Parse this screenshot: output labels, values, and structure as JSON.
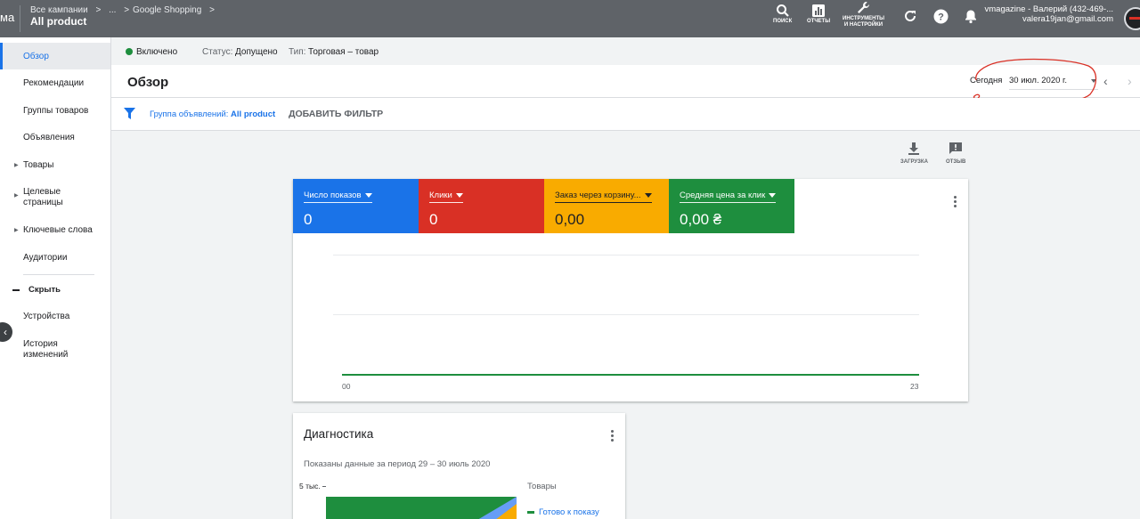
{
  "topbar": {
    "product_fragment": "ма",
    "crumb_parent": "Все кампании",
    "crumb_sep1": ">",
    "crumb_ellipsis": "...",
    "crumb_sep2": ">",
    "crumb_campaign": "Google Shopping",
    "crumb_sep3": ">",
    "page_title": "All product",
    "tools": {
      "search": "ПОИСК",
      "reports": "ОТЧЕТЫ",
      "tools_line1": "ИНСТРУМЕНТЫ",
      "tools_line2": "И НАСТРОЙКИ"
    },
    "account_name": "vmagazine - Валерий (432-469-...",
    "account_email": "valera19jan@gmail.com"
  },
  "sidebar": {
    "items": [
      {
        "label": "Обзор"
      },
      {
        "label": "Рекомендации"
      },
      {
        "label": "Группы товаров"
      },
      {
        "label": "Объявления"
      },
      {
        "label": "Товары"
      },
      {
        "label": "Целевые страницы"
      },
      {
        "label": "Ключевые слова"
      },
      {
        "label": "Аудитории"
      }
    ],
    "hide_label": "Скрыть",
    "extra_items": [
      {
        "label": "Устройства"
      },
      {
        "label": "История изменений"
      }
    ]
  },
  "status": {
    "enabled": "Включено",
    "status_label": "Статус:",
    "status_value": "Допущено",
    "type_label": "Тип:",
    "type_value": "Торговая – товар"
  },
  "header": {
    "title": "Обзор",
    "date_label": "Сегодня",
    "date_value": "30 июл. 2020 г."
  },
  "filter": {
    "group_label": "Группа объявлений:",
    "group_value": "All product",
    "add_filter": "ДОБАВИТЬ ФИЛЬТР"
  },
  "actions": {
    "download": "ЗАГРУЗКА",
    "feedback": "ОТЗЫВ"
  },
  "metrics": [
    {
      "name": "Число показов",
      "value": "0",
      "color": "#1a73e8"
    },
    {
      "name": "Клики",
      "value": "0",
      "color": "#d93025"
    },
    {
      "name": "Заказ через корзину...",
      "value": "0,00",
      "color": "#f9ab00"
    },
    {
      "name": "Средняя цена за клик",
      "value": "0,00 ₴",
      "color": "#1e8e3e"
    }
  ],
  "chart_data": {
    "type": "line",
    "x": [
      "00",
      "23"
    ],
    "series": [
      {
        "values": [
          0,
          0
        ]
      }
    ]
  },
  "diagnostics": {
    "title": "Диагностика",
    "subtitle": "Показаны данные за период 29 – 30 июль 2020",
    "y_label": "5 тыс.",
    "legend_title": "Товары",
    "legend_item": "Готово к показу"
  },
  "colors": {
    "accent": "#1a73e8",
    "topbar": "#5f6368",
    "annotation": "#d93025"
  }
}
